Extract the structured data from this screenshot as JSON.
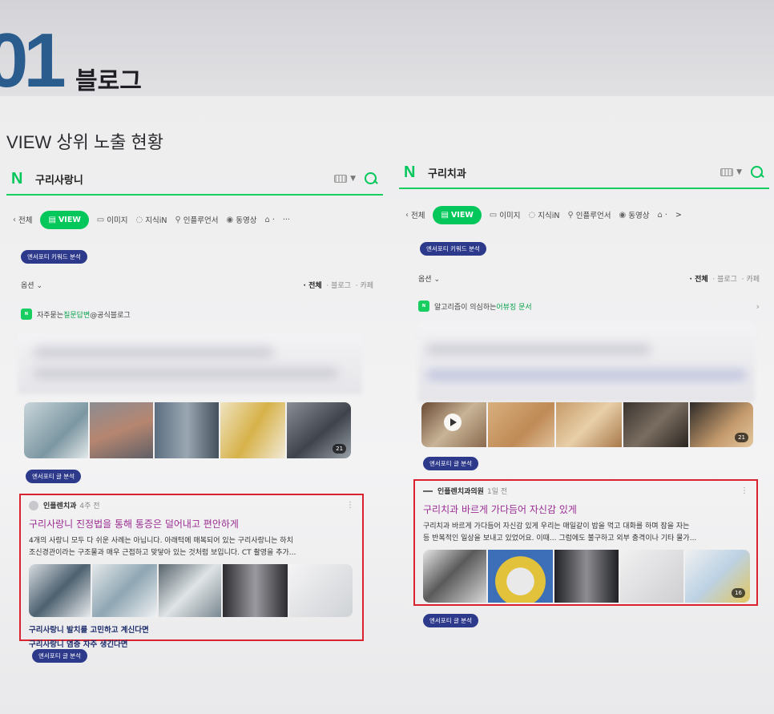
{
  "header": {
    "section_number": "01",
    "section_title": "블로그",
    "subtitle": "VIEW 상위 노출 현황"
  },
  "colors": {
    "naver_green": "#03c75a",
    "highlight_red": "#d9232e",
    "badge_navy": "#2d3a8c",
    "title_purple": "#9b2c93",
    "hero_blue": "#2a5c8e"
  },
  "left": {
    "query": "구리사랑니",
    "tabs": [
      {
        "label": "전체",
        "icon": "chevron-left-icon"
      },
      {
        "label": "VIEW",
        "icon": "view-icon",
        "active": true
      },
      {
        "label": "이미지",
        "icon": "image-icon"
      },
      {
        "label": "지식iN",
        "icon": "qna-icon"
      },
      {
        "label": "인플루언서",
        "icon": "person-icon"
      },
      {
        "label": "동영상",
        "icon": "play-circle-icon"
      },
      {
        "label": "·",
        "icon": "shopping-bag-icon"
      },
      {
        "label": "···",
        "icon": "more-icon"
      }
    ],
    "keyword_badge": "엔서포티 키워드 분석",
    "options_label": "옵션",
    "filters": [
      "전체",
      "블로그",
      "카페"
    ],
    "info": {
      "prefix": "자주묻는 ",
      "link": "질문답변",
      "suffix": " @공식블로그"
    },
    "gallery_count": "21",
    "post_badge": "엔서포티 글 분석",
    "card": {
      "author": "인플렌치과",
      "time": "4주 전",
      "title": "구리사랑니 진정법을 통해 통증은 덜어내고 편안하게",
      "desc1": "4개의 사랑니 모두 다 쉬운 사례는 아닙니다. 아래턱에 매복되어 있는 구리사랑니는 하치",
      "desc2": "조신경관이라는 구조물과 매우 근접하고 맞닿아 있는 것처럼 보입니다. CT 촬영을 추가...",
      "related": [
        "구리사랑니 발치를 고민하고 계신다면",
        "구리사랑니 염증 자주 생긴다면"
      ]
    },
    "bottom_badge": "엔서포티 글 분석"
  },
  "right": {
    "query": "구리치과",
    "tabs": [
      {
        "label": "전체",
        "icon": "chevron-left-icon"
      },
      {
        "label": "VIEW",
        "icon": "view-icon",
        "active": true
      },
      {
        "label": "이미지",
        "icon": "image-icon"
      },
      {
        "label": "지식iN",
        "icon": "qna-icon"
      },
      {
        "label": "인플루언서",
        "icon": "person-icon"
      },
      {
        "label": "동영상",
        "icon": "play-circle-icon"
      },
      {
        "label": "·",
        "icon": "shopping-bag-icon"
      },
      {
        "label": ">",
        "icon": "chevron-right-icon"
      }
    ],
    "keyword_badge": "엔서포티 키워드 분석",
    "options_label": "옵션",
    "filters": [
      "전체",
      "블로그",
      "카페"
    ],
    "info": {
      "prefix": "알고리즘이 의심하는 ",
      "link": "어뷰징 문서",
      "suffix": ""
    },
    "gallery_count": "21",
    "post_badge": "엔서포티 글 분석",
    "card": {
      "author": "인플렌치과의원",
      "time": "1일 전",
      "title": "구리치과 바르게 가다듬어 자신감 있게",
      "desc1": "구리치과 바르게 가다듬어 자신감 있게 우리는 매일같이 밥을 먹고 대화를 하며 잠을 자는",
      "desc2": "등 반복적인 일상을 보내고 있었어요. 이때... 그럼에도 불구하고 외부 충격이나 기타 물가...",
      "image_count": "16"
    },
    "bottom_badge": "엔서포티 글 분석"
  }
}
